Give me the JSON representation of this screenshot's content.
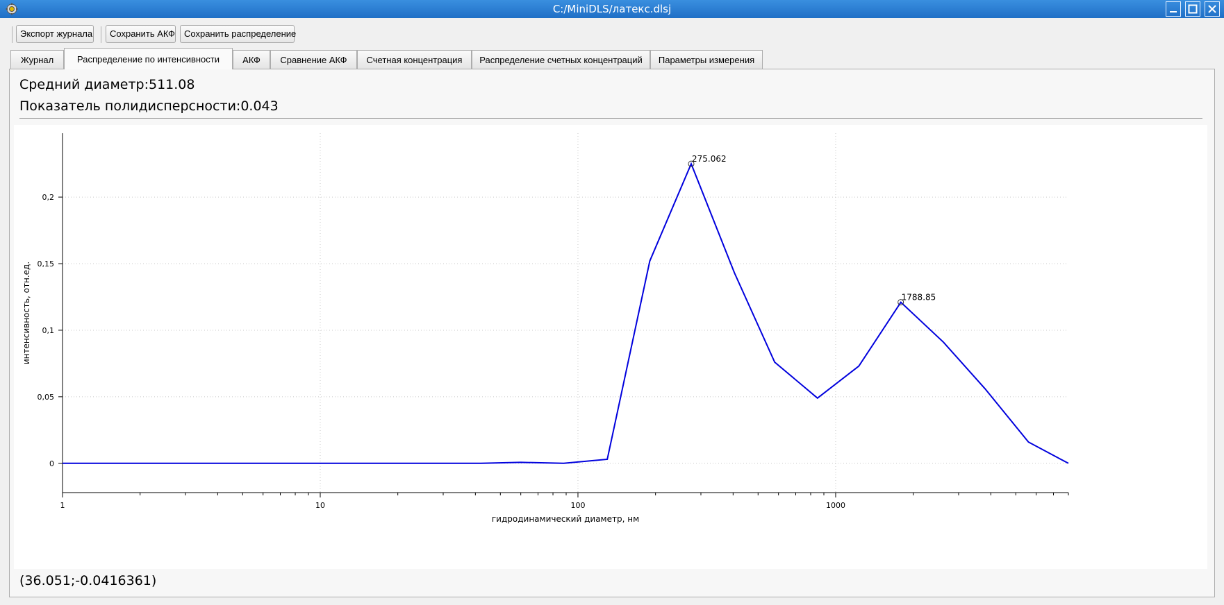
{
  "window": {
    "title": "C:/MiniDLS/латекс.dlsj"
  },
  "toolbar": {
    "export_log": "Экспорт журнала",
    "save_acf": "Сохранить АКФ",
    "save_distribution": "Сохранить распределение"
  },
  "tabs": [
    {
      "label": "Журнал",
      "active": false
    },
    {
      "label": "Распределение по интенсивности",
      "active": true
    },
    {
      "label": "АКФ",
      "active": false
    },
    {
      "label": "Сравнение АКФ",
      "active": false
    },
    {
      "label": "Счетная концентрация",
      "active": false
    },
    {
      "label": "Распределение счетных концентраций",
      "active": false
    },
    {
      "label": "Параметры измерения",
      "active": false
    }
  ],
  "stats": {
    "mean_diameter": "Средний диаметр:511.08",
    "pdi": "Показатель полидисперсности:0.043"
  },
  "cursor_readout": "(36.051;-0.0416361)",
  "chart_data": {
    "type": "line",
    "xlabel": "гидродинамический диаметр, нм",
    "ylabel": "интенсивность, отн.ед.",
    "x_scale": "log",
    "xlim": [
      1,
      8000
    ],
    "ylim": [
      -0.022,
      0.248
    ],
    "x_ticks": [
      1,
      10,
      100,
      1000
    ],
    "x_tick_labels": [
      "1",
      "10",
      "100",
      "1000"
    ],
    "y_ticks": [
      0,
      0.05,
      0.1,
      0.15,
      0.2
    ],
    "y_tick_labels": [
      "0",
      "0,05",
      "0,1",
      "0,15",
      "0,2"
    ],
    "grid": true,
    "line_color": "#0000dd",
    "series": [
      {
        "x": [
          1,
          42,
          60,
          88,
          130,
          190,
          275,
          405,
          580,
          850,
          1230,
          1790,
          2620,
          3800,
          5600,
          8000
        ],
        "y": [
          0,
          0,
          0.0007,
          0,
          0.003,
          0.152,
          0.225,
          0.143,
          0.076,
          0.049,
          0.073,
          0.121,
          0.091,
          0.056,
          0.016,
          0
        ]
      }
    ],
    "peaks": [
      {
        "x": 275.062,
        "y": 0.225,
        "label": "275.062"
      },
      {
        "x": 1788.85,
        "y": 0.121,
        "label": "1788.85"
      }
    ]
  }
}
